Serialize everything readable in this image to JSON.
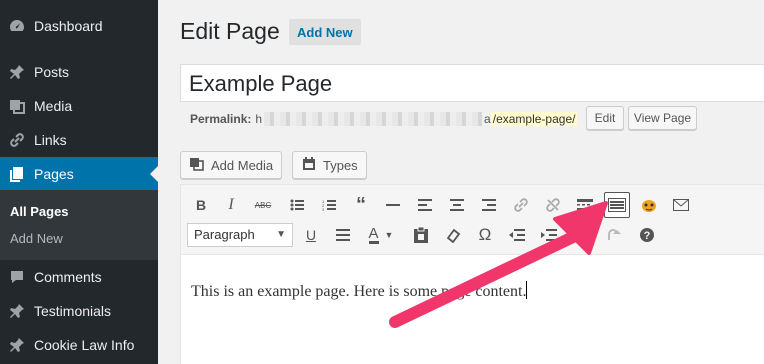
{
  "sidebar": {
    "items": [
      {
        "label": "Dashboard",
        "icon": "dashboard-icon"
      },
      {
        "label": "Posts",
        "icon": "pin-icon"
      },
      {
        "label": "Media",
        "icon": "media-icon"
      },
      {
        "label": "Links",
        "icon": "link-icon"
      },
      {
        "label": "Pages",
        "icon": "pages-icon"
      },
      {
        "label": "Comments",
        "icon": "comments-icon"
      },
      {
        "label": "Testimonials",
        "icon": "testimonials-icon"
      },
      {
        "label": "Cookie Law Info",
        "icon": "cookie-icon"
      }
    ],
    "submenu": [
      "All Pages",
      "Add New"
    ],
    "active": "Pages",
    "accent": "#0073aa"
  },
  "header": {
    "title": "Edit Page",
    "add_new": "Add New"
  },
  "title_field": {
    "value": "Example Page"
  },
  "permalink": {
    "label": "Permalink:",
    "prefix": "h",
    "suffix_start": "a",
    "slug": "/example-page/",
    "edit": "Edit",
    "view": "View Page"
  },
  "media_buttons": {
    "add_media": "Add Media",
    "types": "Types"
  },
  "editor": {
    "format_select": "Paragraph",
    "content": "This is an example page. Here is some page content.",
    "row1_icons": [
      "bold-icon",
      "italic-icon",
      "strikethrough-icon",
      "bullet-list-icon",
      "numbered-list-icon",
      "blockquote-icon",
      "horizontal-rule-icon",
      "align-left-icon",
      "align-center-icon",
      "align-right-icon",
      "insert-link-icon",
      "remove-link-icon",
      "read-more-icon",
      "toolbar-toggle-icon",
      "plugin-icon",
      "email-icon"
    ],
    "row2_icons": [
      "underline-icon",
      "justify-icon",
      "text-color-icon",
      "paste-text-icon",
      "clear-formatting-icon",
      "special-character-icon",
      "outdent-icon",
      "indent-icon",
      "undo-icon",
      "redo-icon",
      "help-icon"
    ]
  },
  "annotation": {
    "arrow_color": "#f0366a"
  }
}
